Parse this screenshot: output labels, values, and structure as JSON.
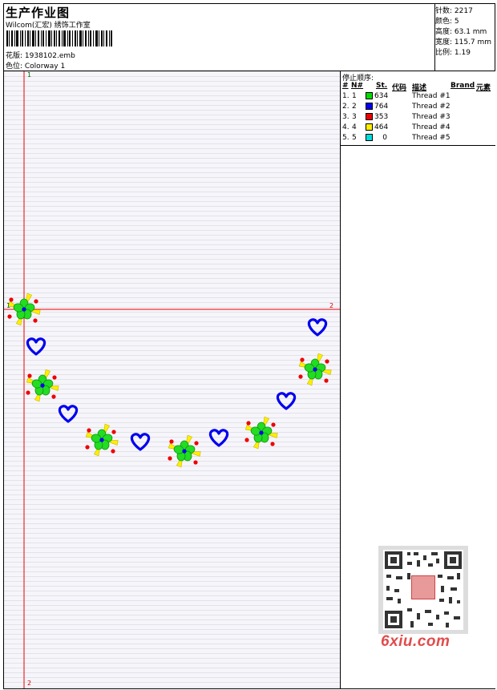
{
  "header": {
    "title": "生产作业图",
    "company": "Wilcom(汇宏) 绣饰工作室",
    "design_label": "花版: 1938102.emb",
    "colorway_label": "色位: Colorway 1"
  },
  "stats": {
    "stitches": "针数: 2217",
    "colors": "颜色: 5",
    "height": "高度: 63.1 mm",
    "width": "宽度: 115.7 mm",
    "scale": "比例: 1.19"
  },
  "sequence": {
    "title": "停止顺序:",
    "headers": {
      "num": "#",
      "n": "N#",
      "st": "St.",
      "code": "代码",
      "desc": "描述",
      "brand": "Brand",
      "element": "元素"
    },
    "rows": [
      {
        "num": "1.",
        "n": "1",
        "color": "#00dd00",
        "stitches": "634",
        "desc": "Thread #1"
      },
      {
        "num": "2.",
        "n": "2",
        "color": "#0000ee",
        "stitches": "764",
        "desc": "Thread #2"
      },
      {
        "num": "3.",
        "n": "3",
        "color": "#ee0000",
        "stitches": "353",
        "desc": "Thread #3"
      },
      {
        "num": "4.",
        "n": "4",
        "color": "#ffee00",
        "stitches": "464",
        "desc": "Thread #4"
      },
      {
        "num": "5.",
        "n": "5",
        "color": "#00dddd",
        "stitches": "0",
        "desc": "Thread #5"
      }
    ]
  },
  "guides": {
    "v_top": "1",
    "v_bottom": "2",
    "h_left": "1",
    "h_right": "2"
  },
  "brand": {
    "text": "6xiu.com"
  },
  "icons": {
    "flower": "flower-motif-icon",
    "heart": "heart-motif-icon",
    "qr": "qr-code-icon"
  },
  "colors": {
    "guide": "#ee0000",
    "green_stitch": "#00dd00",
    "blue_stitch": "#0000ee",
    "red_stitch": "#ee0000",
    "yellow_stitch": "#ffee00"
  }
}
